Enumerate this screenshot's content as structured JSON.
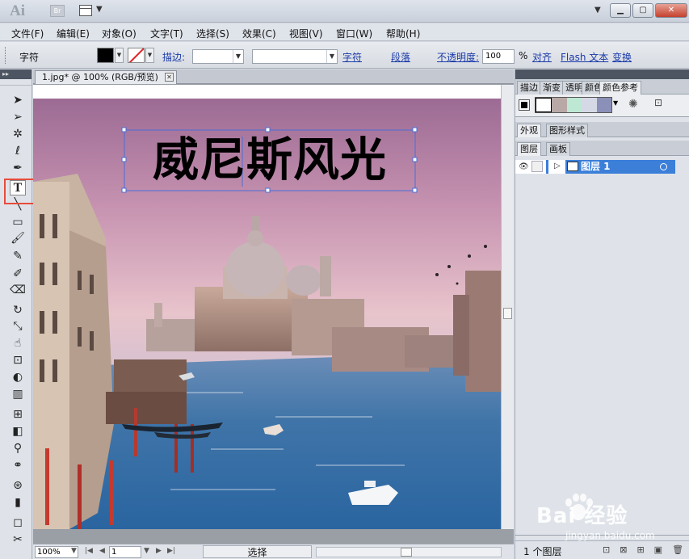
{
  "app": {
    "logo": "Ai",
    "bridge_label": "Br"
  },
  "window": {
    "minimize": "▁",
    "maximize": "▢",
    "close": "✕"
  },
  "menu": [
    "文件(F)",
    "编辑(E)",
    "对象(O)",
    "文字(T)",
    "选择(S)",
    "效果(C)",
    "视图(V)",
    "窗口(W)",
    "帮助(H)"
  ],
  "control": {
    "tool_label": "字符",
    "stroke_label": "描边:",
    "char_link": "字符",
    "para_link": "段落",
    "opacity_label": "不透明度:",
    "opacity_value": "100",
    "percent": "%",
    "align_link": "对齐",
    "flash_link": "Flash 文本",
    "transform_link": "变换"
  },
  "document": {
    "tab_title": "1.jpg* @ 100% (RGB/预览)",
    "text_object": "威尼斯风光",
    "zoom": "100%",
    "page": "1",
    "status_tool": "选择"
  },
  "panels": {
    "top_tabs": [
      "描边",
      "渐变",
      "透明",
      "颜色",
      "颜色参考"
    ],
    "mid_tabs": [
      "外观",
      "图形样式"
    ],
    "layer_tabs": [
      "图层",
      "画板"
    ],
    "layer_name": "图层 1",
    "footer": "1 个图层"
  },
  "colors": {
    "accent": "#3b7fd9",
    "highlight": "#e84c3c"
  },
  "watermark": {
    "brand": "Bai 经验",
    "url": "jingyan.baidu.com"
  },
  "tools": [
    "selection-tool",
    "direct-selection-tool",
    "magic-wand-tool",
    "lasso-tool",
    "pen-tool",
    "type-tool",
    "line-tool",
    "rectangle-tool",
    "paintbrush-tool",
    "pencil-tool",
    "blob-brush-tool",
    "eraser-tool",
    "rotate-tool",
    "scale-tool",
    "warp-tool",
    "free-transform-tool",
    "shape-builder-tool",
    "perspective-grid-tool",
    "mesh-tool",
    "gradient-tool",
    "eyedropper-tool",
    "blend-tool",
    "symbol-sprayer-tool",
    "column-graph-tool",
    "artboard-tool",
    "slice-tool"
  ]
}
